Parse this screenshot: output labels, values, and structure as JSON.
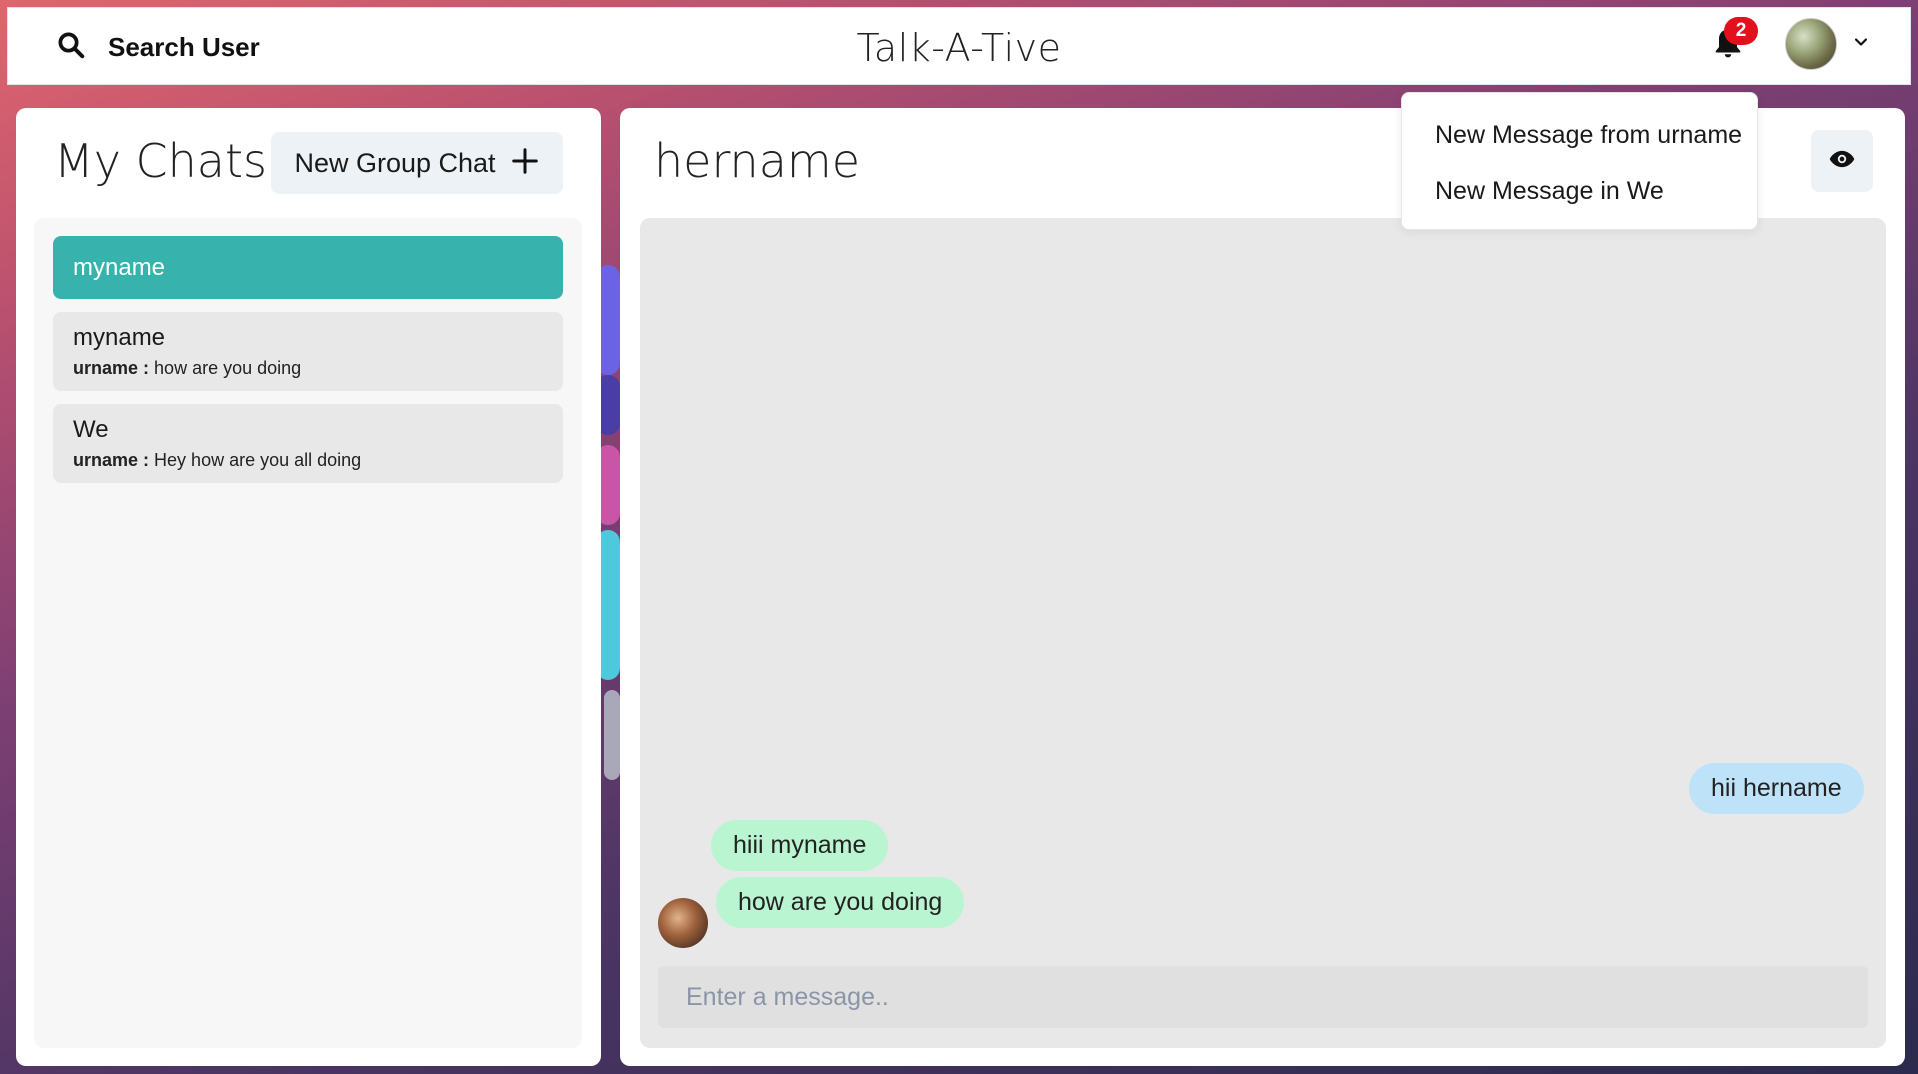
{
  "header": {
    "search_label": "Search User",
    "app_title": "Talk-A-Tive",
    "notification_count": "2"
  },
  "notifications": [
    "New Message from urname",
    "New Message in We"
  ],
  "left": {
    "title": "My Chats",
    "new_group_label": "New Group Chat"
  },
  "chats": [
    {
      "name": "myname",
      "active": true
    },
    {
      "name": "myname",
      "sender": "urname :",
      "latest": "how are you doing"
    },
    {
      "name": "We",
      "sender": "urname :",
      "latest": "Hey how are you all doing"
    }
  ],
  "chat": {
    "name": "hername",
    "messages": [
      {
        "text": "hii hername",
        "type": "sent"
      },
      {
        "text": "hiii myname",
        "type": "received"
      },
      {
        "text": "how are you doing",
        "type": "received"
      }
    ],
    "input_placeholder": "Enter a message.."
  },
  "colors": {
    "active_chat": "#38b2ac",
    "sent_bubble": "#bee3f8",
    "received_bubble": "#b9f5d0",
    "badge": "#e2101d"
  },
  "icons": [
    "search-icon",
    "bell-icon",
    "chevron-down-icon",
    "plus-icon",
    "eye-icon"
  ]
}
